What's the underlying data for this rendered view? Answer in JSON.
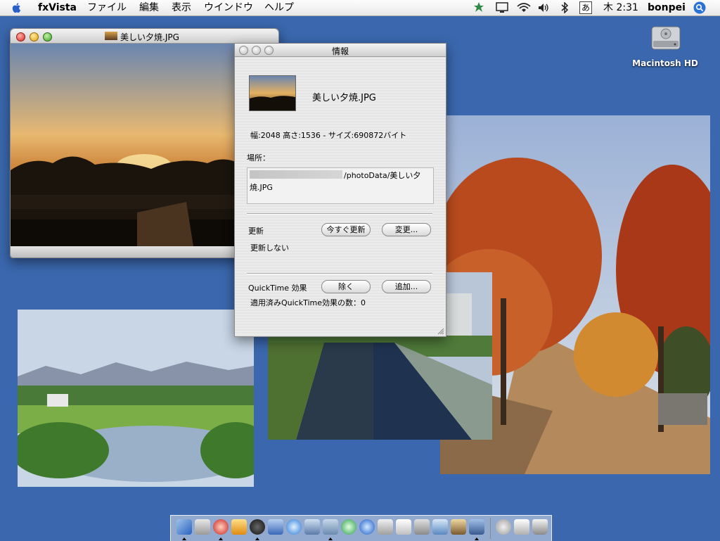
{
  "menubar": {
    "app_name": "fxVista",
    "menus": [
      "ファイル",
      "編集",
      "表示",
      "ウインドウ",
      "ヘルプ"
    ],
    "ime": "あ",
    "clock": "木 2:31",
    "user": "bonpei"
  },
  "desktop": {
    "hd_label": "Macintosh HD"
  },
  "viewer_window": {
    "title": "美しい夕焼.JPG"
  },
  "info_window": {
    "title": "情報",
    "file_name": "美しい夕焼.JPG",
    "dimensions": "幅:2048 高さ:1536 - サイズ:690872バイト",
    "location_label": "場所：",
    "path_line1": "/photoData/美しい夕",
    "path_line2": "焼.JPG",
    "update_label": "更新",
    "update_now_button": "今すぐ更新",
    "change_button": "変更...",
    "update_status": "更新しない",
    "quicktime_label": "QuickTime 効果",
    "remove_button": "除く",
    "add_button": "追加...",
    "quicktime_count": "適用済みQuickTime効果の数：0"
  },
  "colors": {
    "desktop": "#3a67ad",
    "window_bg": "#ececec"
  }
}
